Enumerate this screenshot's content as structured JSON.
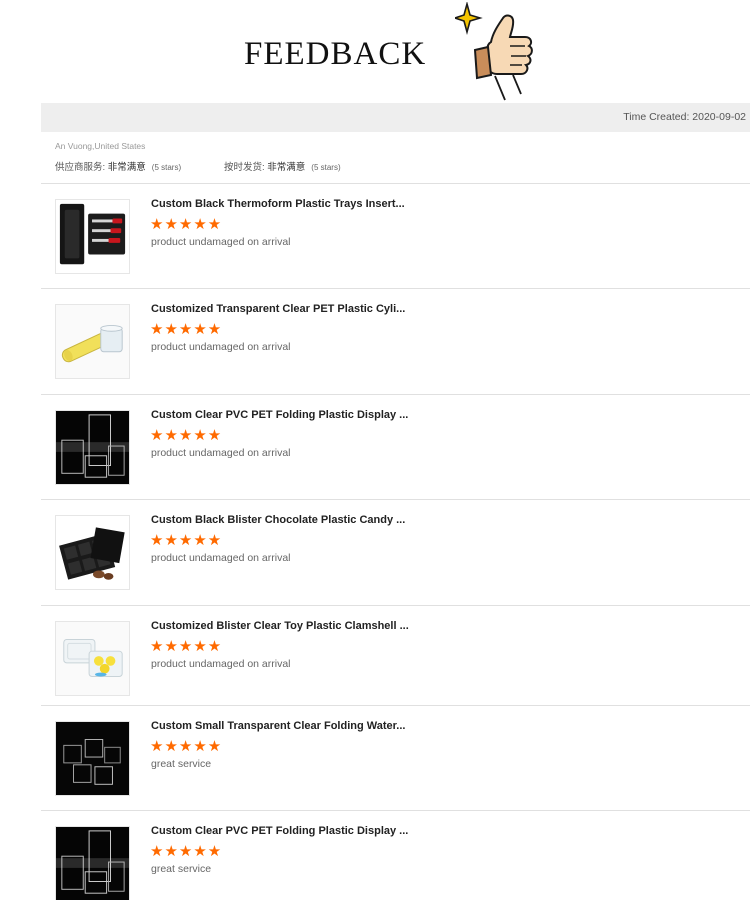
{
  "header": {
    "title": "FEEDBACK",
    "logo_icon": "thumbs-up-sparkle-icon"
  },
  "meta": {
    "time_created": "Time Created: 2020-09-02"
  },
  "buyer": {
    "name": "An Vuong,United States"
  },
  "ratings": [
    {
      "label": "供应商服务: ",
      "value": "非常满意",
      "stars": "(5 stars)"
    },
    {
      "label": "按时发货: ",
      "value": "非常满意",
      "stars": "(5 stars)"
    }
  ],
  "colors": {
    "star": "#ff6a00",
    "bar": "#eeeeee"
  },
  "items": [
    {
      "title": "Custom Black Thermoform Plastic Trays Insert...",
      "rating": 5,
      "stars": "★★★★★",
      "comment": "product undamaged on arrival",
      "image": "black-tray-with-tools"
    },
    {
      "title": "Customized Transparent Clear PET Plastic Cyli...",
      "rating": 5,
      "stars": "★★★★★",
      "comment": "product undamaged on arrival",
      "image": "clear-cylinder-tubes"
    },
    {
      "title": "Custom Clear PVC PET Folding Plastic Display ...",
      "rating": 5,
      "stars": "★★★★★",
      "comment": "product undamaged on arrival",
      "image": "clear-boxes-dark"
    },
    {
      "title": "Custom Black Blister Chocolate Plastic Candy ...",
      "rating": 5,
      "stars": "★★★★★",
      "comment": "product undamaged on arrival",
      "image": "black-candy-tray"
    },
    {
      "title": "Customized Blister Clear Toy Plastic Clamshell ...",
      "rating": 5,
      "stars": "★★★★★",
      "comment": "product undamaged on arrival",
      "image": "clear-clamshell-yellow-balls"
    },
    {
      "title": "Custom Small Transparent Clear Folding Water...",
      "rating": 5,
      "stars": "★★★★★",
      "comment": "great service",
      "image": "small-clear-boxes-dark"
    },
    {
      "title": "Custom Clear PVC PET Folding Plastic Display ...",
      "rating": 5,
      "stars": "★★★★★",
      "comment": "great service",
      "image": "clear-boxes-dark"
    }
  ]
}
